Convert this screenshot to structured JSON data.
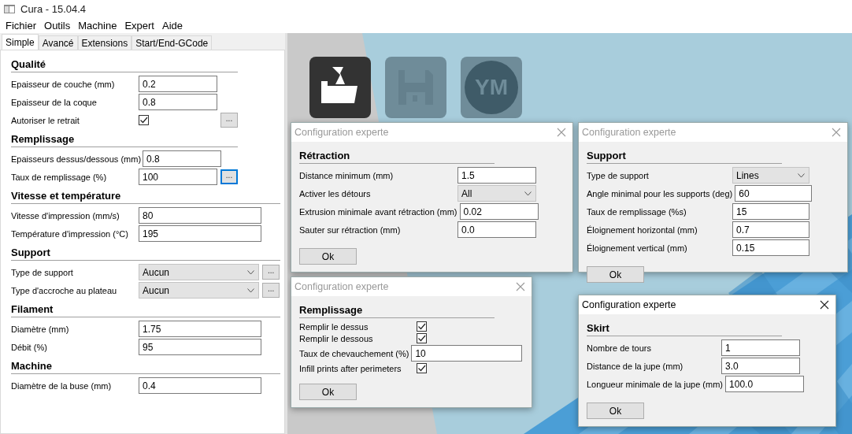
{
  "window": {
    "title": "Cura - 15.04.4"
  },
  "menu": [
    "Fichier",
    "Outils",
    "Machine",
    "Expert",
    "Aide"
  ],
  "tabs": [
    {
      "label": "Simple",
      "selected": true
    },
    {
      "label": "Avancé",
      "selected": false
    },
    {
      "label": "Extensions",
      "selected": false
    },
    {
      "label": "Start/End-GCode",
      "selected": false
    }
  ],
  "sections": [
    {
      "title": "Qualité",
      "rows": [
        {
          "kind": "text",
          "label": "Epaisseur de couche (mm)",
          "value": "0.2"
        },
        {
          "kind": "text",
          "label": "Epaisseur de la coque",
          "value": "0.8"
        },
        {
          "kind": "checkbox",
          "label": "Autoriser le retrait",
          "checked": true,
          "more": {
            "label": "...",
            "focused": false
          }
        }
      ]
    },
    {
      "title": "Remplissage",
      "rows": [
        {
          "kind": "text",
          "label": "Epaisseurs dessus/dessous (mm)",
          "value": "0.8"
        },
        {
          "kind": "text",
          "label": "Taux de remplissage (%)",
          "value": "100",
          "more": {
            "label": "...",
            "focused": true
          }
        }
      ]
    },
    {
      "title": "Vitesse et température",
      "rows": [
        {
          "kind": "text",
          "label": "Vitesse d'impression (mm/s)",
          "value": "80"
        },
        {
          "kind": "text",
          "label": "Température d'impression (°C)",
          "value": "195"
        }
      ]
    },
    {
      "title": "Support",
      "rows": [
        {
          "kind": "select",
          "label": "Type de support",
          "value": "Aucun",
          "more": {
            "label": "...",
            "focused": false
          }
        },
        {
          "kind": "select",
          "label": "Type d'accroche au plateau",
          "value": "Aucun",
          "more": {
            "label": "...",
            "focused": false
          }
        }
      ]
    },
    {
      "title": "Filament",
      "rows": [
        {
          "kind": "text",
          "label": "Diamètre (mm)",
          "value": "1.75"
        },
        {
          "kind": "text",
          "label": "Débit (%)",
          "value": "95"
        }
      ]
    },
    {
      "title": "Machine",
      "rows": [
        {
          "kind": "text",
          "label": "Diamètre de la buse (mm)",
          "value": "0.4"
        }
      ]
    }
  ],
  "toolbar": [
    {
      "kind": "load",
      "disabled": false
    },
    {
      "kind": "save",
      "disabled": true
    },
    {
      "kind": "view",
      "label": "YM",
      "disabled": true
    }
  ],
  "dialogs": [
    {
      "title": "Configuration experte",
      "active": false,
      "heading": "Rétraction",
      "button": "Ok",
      "rows": [
        {
          "kind": "text",
          "label": "Distance minimum (mm)",
          "value": "1.5"
        },
        {
          "kind": "select",
          "label": "Activer les détours",
          "value": "All"
        },
        {
          "kind": "text",
          "label": "Extrusion minimale avant rétraction (mm)",
          "value": "0.02"
        },
        {
          "kind": "text",
          "label": "Sauter sur rétraction (mm)",
          "value": "0.0"
        }
      ]
    },
    {
      "title": "Configuration experte",
      "active": false,
      "heading": "Support",
      "button": "Ok",
      "rows": [
        {
          "kind": "select",
          "label": "Type de support",
          "value": "Lines"
        },
        {
          "kind": "text",
          "label": "Angle minimal pour les supports (deg)",
          "value": "60"
        },
        {
          "kind": "text",
          "label": "Taux de remplissage (%s)",
          "value": "15"
        },
        {
          "kind": "text",
          "label": "Éloignement horizontal (mm)",
          "value": "0.7"
        },
        {
          "kind": "text",
          "label": "Éloignement vertical (mm)",
          "value": "0.15"
        }
      ]
    },
    {
      "title": "Configuration experte",
      "active": false,
      "heading": "Remplissage",
      "button": "Ok",
      "rows": [
        {
          "kind": "checkbox",
          "label": "Remplir le dessus",
          "checked": true
        },
        {
          "kind": "checkbox",
          "label": "Remplir le dessous",
          "checked": true
        },
        {
          "kind": "text",
          "label": "Taux de chevauchement (%)",
          "value": "10"
        },
        {
          "kind": "checkbox",
          "label": "Infill prints after perimeters",
          "checked": true
        }
      ]
    },
    {
      "title": "Configuration experte",
      "active": true,
      "heading": "Skirt",
      "button": "Ok",
      "rows": [
        {
          "kind": "text",
          "label": "Nombre de tours",
          "value": "1"
        },
        {
          "kind": "text",
          "label": "Distance de la jupe (mm)",
          "value": "3.0"
        },
        {
          "kind": "text",
          "label": "Longueur minimale de la jupe (mm)",
          "value": "100.0"
        }
      ]
    }
  ]
}
